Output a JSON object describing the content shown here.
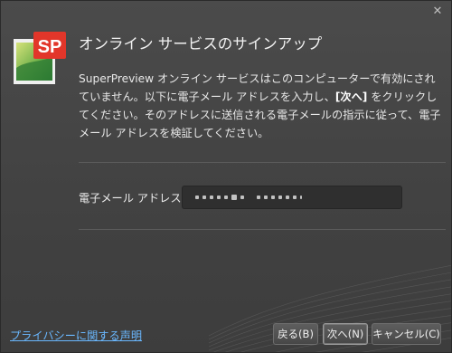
{
  "dialog": {
    "close_glyph": "✕",
    "title": "オンライン サービスのサインアップ",
    "description_pre": "SuperPreview オンライン サービスはこのコンピューターで有効にされていません。以下に電子メール アドレスを入力し、",
    "description_emph": "[次へ]",
    "description_post": " をクリックしてください。そのアドレスに送信される電子メールの指示に従って、電子メール アドレスを検証してください。",
    "email_label": "電子メール アドレス",
    "privacy_link": "プライバシーに関する声明",
    "buttons": {
      "back": "戻る(B)",
      "next": "次へ(N)",
      "cancel": "キャンセル(C)"
    },
    "logo": {
      "text": "SP",
      "icon": "superpreview-logo-icon",
      "accent": "#e2362a"
    }
  }
}
